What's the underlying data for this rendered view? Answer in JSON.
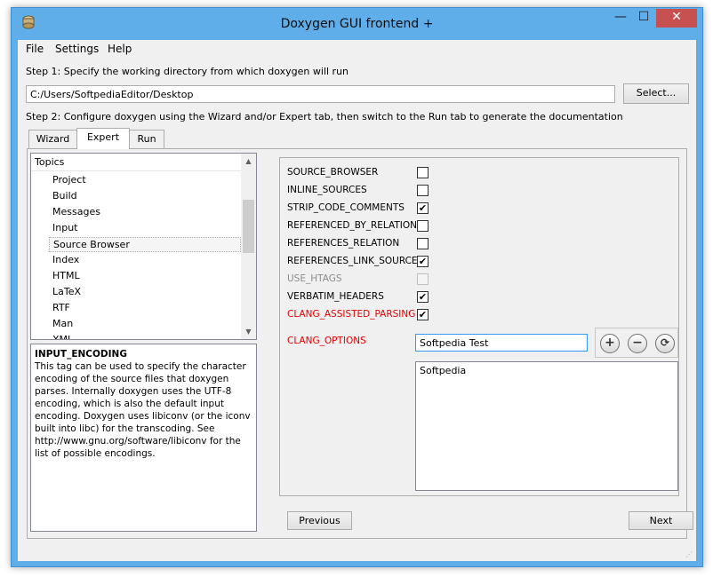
{
  "window": {
    "title": "Doxygen GUI frontend +",
    "minimize_glyph": "—",
    "maximize_glyph": "☐",
    "close_glyph": "✕"
  },
  "menu": {
    "file": "File",
    "settings": "Settings",
    "help": "Help"
  },
  "step1": {
    "text": "Step 1: Specify the working directory from which doxygen will run",
    "directory": "C:/Users/SoftpediaEditor/Desktop",
    "select_label": "Select..."
  },
  "step2": {
    "text": "Step 2: Configure doxygen using the Wizard and/or Expert tab, then switch to the Run tab to generate the documentation"
  },
  "tabs": {
    "wizard": "Wizard",
    "expert": "Expert",
    "run": "Run"
  },
  "topics": {
    "header": "Topics",
    "items": [
      "Project",
      "Build",
      "Messages",
      "Input",
      "Source Browser",
      "Index",
      "HTML",
      "LaTeX",
      "RTF",
      "Man",
      "XML"
    ],
    "selected": "Source Browser"
  },
  "help": {
    "title": "INPUT_ENCODING",
    "body": "This tag can be used to specify the character encoding of the source files that doxygen parses. Internally doxygen uses the UTF-8 encoding, which is also the default input encoding. Doxygen uses libiconv (or the iconv built into libc) for the transcoding. See http://www.gnu.org/software/libiconv for the list of possible encodings."
  },
  "options": [
    {
      "label": "SOURCE_BROWSER",
      "checked": false
    },
    {
      "label": "INLINE_SOURCES",
      "checked": false
    },
    {
      "label": "STRIP_CODE_COMMENTS",
      "checked": true
    },
    {
      "label": "REFERENCED_BY_RELATION",
      "checked": false
    },
    {
      "label": "REFERENCES_RELATION",
      "checked": false
    },
    {
      "label": "REFERENCES_LINK_SOURCE",
      "checked": true
    },
    {
      "label": "USE_HTAGS",
      "checked": false,
      "disabled": true
    },
    {
      "label": "VERBATIM_HEADERS",
      "checked": true
    },
    {
      "label": "CLANG_ASSISTED_PARSING",
      "checked": true,
      "modified": true
    }
  ],
  "clang_options": {
    "label": "CLANG_OPTIONS",
    "value": "Softpedia Test",
    "list": [
      "Softpedia"
    ]
  },
  "buttons": {
    "previous": "Previous",
    "next": "Next"
  },
  "checkmark": "✔",
  "colors": {
    "titlebar": "#5faee9",
    "close": "#c75050",
    "modified_label": "#e60000"
  }
}
